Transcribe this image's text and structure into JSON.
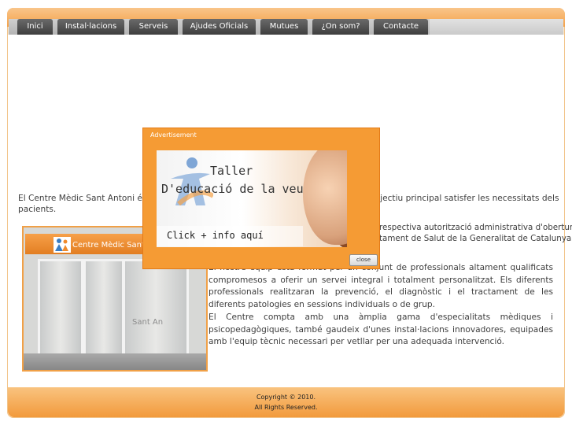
{
  "nav": {
    "items": [
      {
        "label": "Inici"
      },
      {
        "label": "Instal·lacions"
      },
      {
        "label": "Serveis"
      },
      {
        "label": "Ajudes Oficials"
      },
      {
        "label": "Mutues"
      },
      {
        "label": "¿On som?"
      },
      {
        "label": "Contacte"
      }
    ]
  },
  "main": {
    "intro_left": "El Centre Mèdic Sant Antoni és",
    "intro_right": "n o objectiu principal satisfer les necessitats dels",
    "intro_end": "pacients.",
    "p2_right": "respectiva   autorització administrativa d'obertura",
    "p2_line2": "tament de Salut de la Generalitat de Catalunya",
    "p3": "El nostre equip està format per un conjunt de professionals altament qualificats compromesos a oferir un servei integral i totalment personalitzat. Els diferents professionals realitzaran la prevenció, el diagnòstic i el tractament de les diferents patologies en sessions individuals o de grup.",
    "p4": "El Centre compta amb una àmplia gama d'especialitats mèdiques i psicopedagògiques, també gaudeix d'unes instal·lacions innovadores, equipades amb l'equip tècnic necessari per vetllar per una adequada intervenció.",
    "photo_sign": "Centre Mèdic Sant A",
    "photo_door": "Sant An"
  },
  "footer": {
    "line1": "Copyright © 2010.",
    "line2": "All Rights Reserved."
  },
  "modal": {
    "title": "Advertisement",
    "ad_line1": "Taller",
    "ad_line2": "D'educació de la veu",
    "ad_cta": "Click + info aquí",
    "close_label": "close"
  },
  "colors": {
    "accent": "#f59b34",
    "nav_tab": "#4a4a4a",
    "text": "#3e3e3e"
  }
}
